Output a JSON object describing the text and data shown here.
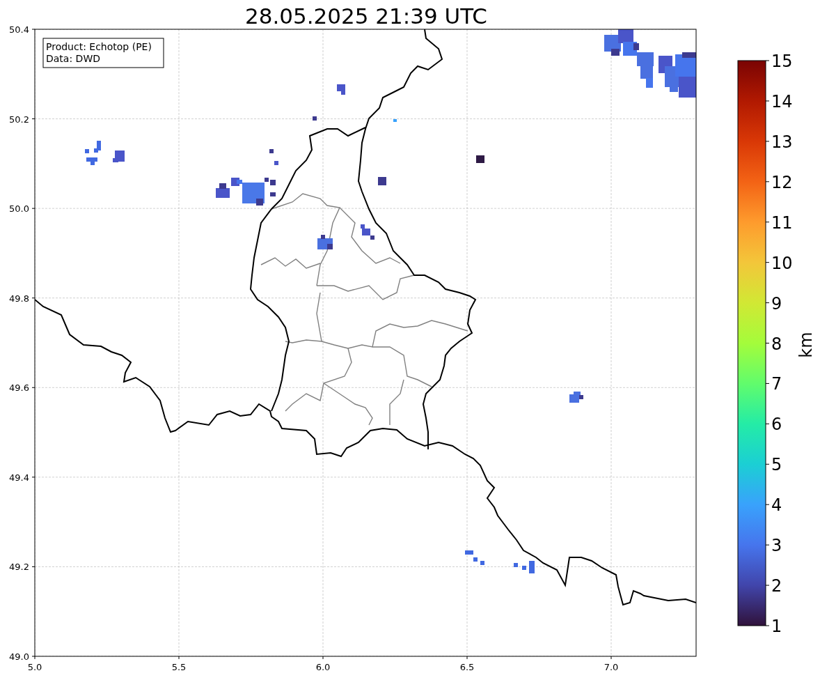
{
  "title": "28.05.2025 21:39 UTC",
  "info_box": [
    "Product: Echotop (PE)",
    "Data: DWD"
  ],
  "map": {
    "x_ticks": [
      "5.0",
      "5.5",
      "6.0",
      "6.5",
      "7.0"
    ],
    "y_ticks": [
      "50.4",
      "50.2",
      "50.0",
      "49.8",
      "49.6",
      "49.4",
      "49.2",
      "49.0"
    ]
  },
  "colorbar": {
    "label": "km",
    "ticks": [
      "15",
      "14",
      "13",
      "12",
      "11",
      "10",
      "9",
      "8",
      "7",
      "6",
      "5",
      "4",
      "3",
      "2",
      "1"
    ]
  }
}
